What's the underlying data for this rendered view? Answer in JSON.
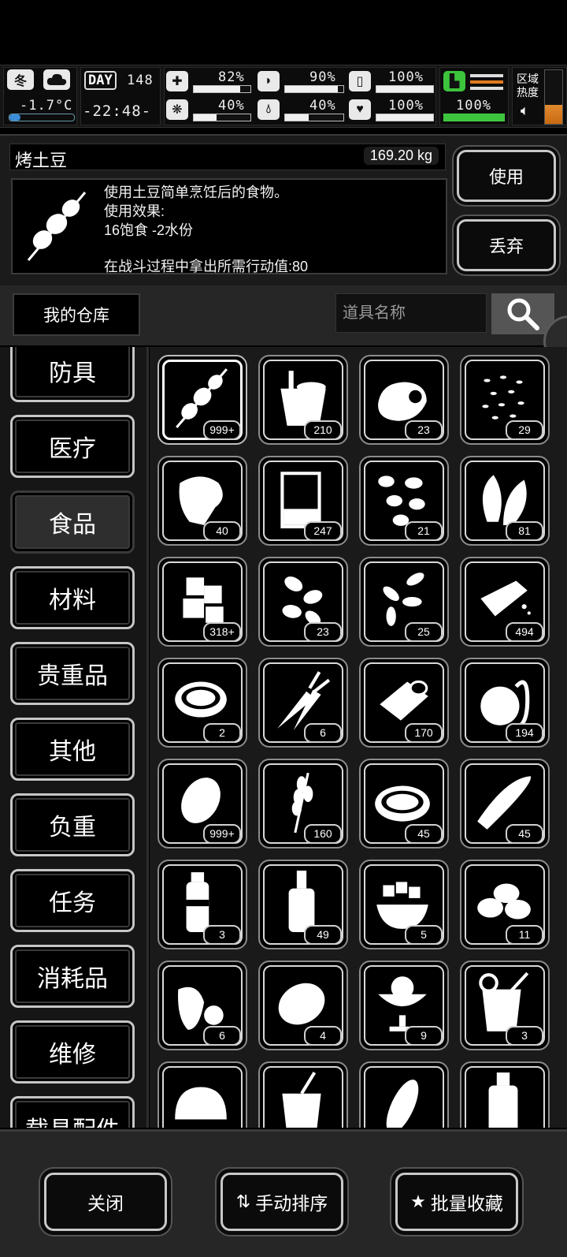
{
  "status": {
    "season": "冬",
    "weather_icon": "cloud-icon",
    "temperature": "-1.7°C",
    "day_label": "DAY",
    "day": "148",
    "time": "-22:48-",
    "stats": [
      {
        "icon": "medkit-icon",
        "value": "82%",
        "fill": 0.82
      },
      {
        "icon": "stomach-icon",
        "value": "90%",
        "fill": 0.9
      },
      {
        "icon": "capsule-icon",
        "value": "100%",
        "fill": 1.0
      },
      {
        "icon": "brain-icon",
        "value": "40%",
        "fill": 0.4
      },
      {
        "icon": "water-drop-icon",
        "value": "40%",
        "fill": 0.4
      },
      {
        "icon": "heart-icon",
        "value": "100%",
        "fill": 1.0
      }
    ],
    "stamina": {
      "value": "100%",
      "fill": 1.0
    },
    "zone_heat_label": "区域\n热度",
    "accent_green": "#3cc43c",
    "accent_orange": "#e07a1e"
  },
  "item": {
    "name": "烤土豆",
    "weight": "169.20 kg",
    "description": [
      "使用土豆简单烹饪后的食物。",
      "使用效果:",
      "16饱食 -2水份",
      "",
      "在战斗过程中拿出所需行动值:80"
    ],
    "use_label": "使用",
    "discard_label": "丢弃"
  },
  "warehouse": {
    "title": "我的仓库",
    "search_placeholder": "道具名称"
  },
  "categories": [
    "防具",
    "医疗",
    "食品",
    "材料",
    "贵重品",
    "其他",
    "负重",
    "任务",
    "消耗品",
    "维修",
    "载具配件"
  ],
  "active_category": "食品",
  "grid": [
    {
      "icon": "grilled-potato-skewer-icon",
      "count": "999+"
    },
    {
      "icon": "bucket-icon",
      "count": "210"
    },
    {
      "icon": "raw-meat-icon",
      "count": "23"
    },
    {
      "icon": "seeds-icon",
      "count": "29"
    },
    {
      "icon": "steak-icon",
      "count": "40"
    },
    {
      "icon": "beaker-icon",
      "count": "247"
    },
    {
      "icon": "beans-icon",
      "count": "21"
    },
    {
      "icon": "leaf-icon",
      "count": "81"
    },
    {
      "icon": "sugar-cubes-icon",
      "count": "318+"
    },
    {
      "icon": "almonds-icon",
      "count": "23"
    },
    {
      "icon": "sunflower-seeds-icon",
      "count": "25"
    },
    {
      "icon": "tofu-block-icon",
      "count": "494"
    },
    {
      "icon": "stew-pot-icon",
      "count": "2"
    },
    {
      "icon": "carrot-icon",
      "count": "6"
    },
    {
      "icon": "canned-food-icon",
      "count": "170"
    },
    {
      "icon": "apple-icon",
      "count": "194"
    },
    {
      "icon": "potato-icon",
      "count": "999+"
    },
    {
      "icon": "wheat-icon",
      "count": "160"
    },
    {
      "icon": "soup-bowl-icon",
      "count": "45"
    },
    {
      "icon": "baguette-icon",
      "count": "45"
    },
    {
      "icon": "sauce-bottle-icon",
      "count": "3"
    },
    {
      "icon": "liquor-bottle-icon",
      "count": "49"
    },
    {
      "icon": "fruit-bowl-icon",
      "count": "5"
    },
    {
      "icon": "coffee-beans-icon",
      "count": "11"
    },
    {
      "icon": "strawberry-icon",
      "count": "6"
    },
    {
      "icon": "lemon-icon",
      "count": "4"
    },
    {
      "icon": "sundae-icon",
      "count": "9"
    },
    {
      "icon": "juice-glass-icon",
      "count": "3"
    },
    {
      "icon": "bread-loaf-icon",
      "count": ""
    },
    {
      "icon": "soda-cup-icon",
      "count": ""
    },
    {
      "icon": "corn-icon",
      "count": ""
    },
    {
      "icon": "pickle-jar-icon",
      "count": ""
    }
  ],
  "bottom": {
    "close_label": "关闭",
    "sort_label": "手动排序",
    "favorite_label": "批量收藏"
  }
}
